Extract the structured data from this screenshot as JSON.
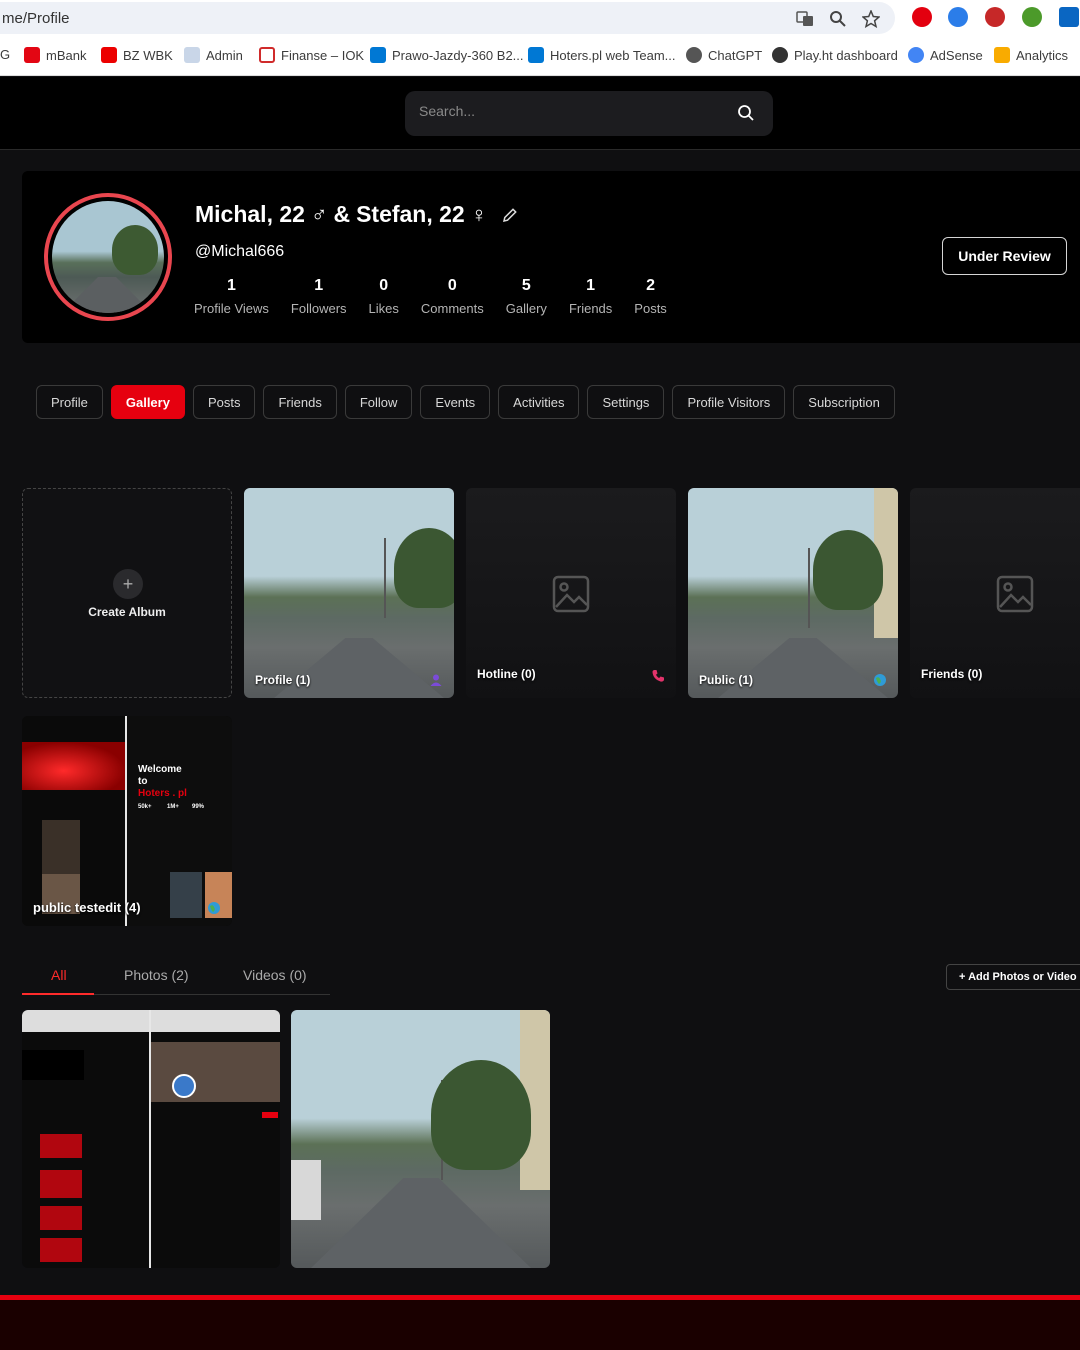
{
  "browser": {
    "url": "me/Profile",
    "bookmarks": [
      {
        "label": "G",
        "color": "#888888"
      },
      {
        "label": "mBank",
        "color": "#e30613"
      },
      {
        "label": "BZ WBK",
        "color": "#ec0000"
      },
      {
        "label": "Admin",
        "color": "#7a9cc6"
      },
      {
        "label": "Finanse – IOK",
        "color": "#d02b2b"
      },
      {
        "label": "Prawo-Jazdy-360 B2...",
        "color": "#0078d4"
      },
      {
        "label": "Hoters.pl web Team...",
        "color": "#0078d4"
      },
      {
        "label": "ChatGPT",
        "color": "#333333"
      },
      {
        "label": "Play.ht dashboard",
        "color": "#333333"
      },
      {
        "label": "AdSense",
        "color": "#4285f4"
      },
      {
        "label": "Analytics",
        "color": "#f9ab00"
      }
    ]
  },
  "header": {
    "search_placeholder": "Search..."
  },
  "profile": {
    "name_part1": "Michal, 22",
    "gender1": "♂",
    "name_join": "&",
    "name_part2": "Stefan, 22",
    "gender2": "♀",
    "username": "@Michal666",
    "review_label": "Under Review",
    "stats": [
      {
        "value": "1",
        "label": "Profile Views"
      },
      {
        "value": "1",
        "label": "Followers"
      },
      {
        "value": "0",
        "label": "Likes"
      },
      {
        "value": "0",
        "label": "Comments"
      },
      {
        "value": "5",
        "label": "Gallery"
      },
      {
        "value": "1",
        "label": "Friends"
      },
      {
        "value": "2",
        "label": "Posts"
      }
    ]
  },
  "tabs": [
    "Profile",
    "Gallery",
    "Posts",
    "Friends",
    "Follow",
    "Events",
    "Activities",
    "Settings",
    "Profile Visitors",
    "Subscription"
  ],
  "active_tab": "Gallery",
  "albums": {
    "create_label": "Create Album",
    "profile_label": "Profile (1)",
    "hotline_label": "Hotline (0)",
    "public_label": "Public (1)",
    "friends_label": "Friends (0)",
    "testedit_label": "public testedit (4)",
    "shot_welcome": "Welcome",
    "shot_to": "to",
    "shot_brand": "Hoters . pl",
    "shot_stat1": "50k+",
    "shot_stat2": "1M+",
    "shot_stat3": "99%"
  },
  "media_tabs": {
    "all": "All",
    "photos": "Photos (2)",
    "videos": "Videos (0)",
    "add_button": "+  Add Photos or Video"
  },
  "colors": {
    "accent": "#e6000f",
    "avatar_ring": "#e9464f"
  }
}
